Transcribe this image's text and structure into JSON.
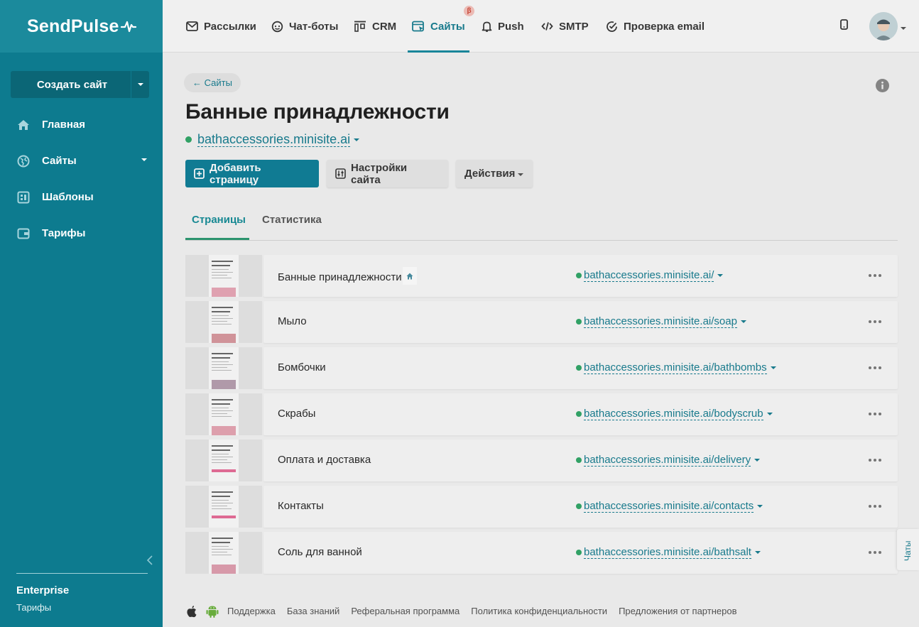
{
  "sidebar": {
    "logo": "SendPulse",
    "create_button": "Создать сайт",
    "items": [
      {
        "label": "Главная"
      },
      {
        "label": "Сайты"
      },
      {
        "label": "Шаблоны"
      },
      {
        "label": "Тарифы"
      }
    ],
    "plan_name": "Enterprise",
    "plan_link": "Тарифы"
  },
  "topnav": {
    "items": [
      {
        "label": "Рассылки",
        "icon": "mail-icon"
      },
      {
        "label": "Чат-боты",
        "icon": "chatbot-icon"
      },
      {
        "label": "CRM",
        "icon": "crm-icon"
      },
      {
        "label": "Сайты",
        "icon": "sites-icon",
        "active": true
      },
      {
        "label": "Push",
        "icon": "bell-icon"
      },
      {
        "label": "SMTP",
        "icon": "code-icon"
      },
      {
        "label": "Проверка email",
        "icon": "check-circle-icon"
      }
    ],
    "beta_badge": "β"
  },
  "main": {
    "back_link": "← Сайты",
    "title": "Банные принадлежности",
    "domain": "bathaccessories.minisite.ai",
    "buttons": {
      "add_page": "Добавить страницу",
      "site_settings": "Настройки сайта",
      "actions": "Действия"
    },
    "tabs": [
      {
        "label": "Страницы",
        "active": true
      },
      {
        "label": "Статистика"
      }
    ],
    "pages": [
      {
        "name": "Банные принадлежности",
        "url": "bathaccessories.minisite.ai/",
        "is_home": true
      },
      {
        "name": "Мыло",
        "url": "bathaccessories.minisite.ai/soap"
      },
      {
        "name": "Бомбочки",
        "url": "bathaccessories.minisite.ai/bathbombs"
      },
      {
        "name": "Скрабы",
        "url": "bathaccessories.minisite.ai/bodyscrub"
      },
      {
        "name": "Оплата и доставка",
        "url": "bathaccessories.minisite.ai/delivery"
      },
      {
        "name": "Контакты",
        "url": "bathaccessories.minisite.ai/contacts"
      },
      {
        "name": "Соль для ванной",
        "url": "bathaccessories.minisite.ai/bathsalt"
      }
    ]
  },
  "chat_tab": "Чаты",
  "footer": {
    "links": [
      "Поддержка",
      "База знаний",
      "Реферальная программа",
      "Политика конфиденциальности",
      "Предложения от партнеров"
    ]
  },
  "colors": {
    "sidebar": "#0d7b8f",
    "accent": "#1a7f92",
    "primary_button": "#11819a",
    "status_green": "#34a86a"
  }
}
